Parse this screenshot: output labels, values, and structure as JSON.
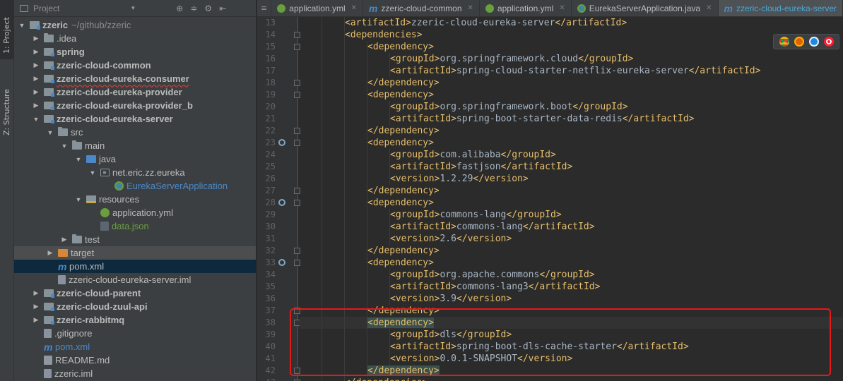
{
  "tool_strip": {
    "project_tab": "1: Project",
    "structure_tab": "Z: Structure"
  },
  "project_panel": {
    "title": "Project",
    "tree": [
      {
        "label": "zzeric",
        "path": "~/github/zzeric",
        "icon": "module-folder-icon",
        "arrow": "down",
        "depth": 0,
        "bold": true
      },
      {
        "label": ".idea",
        "icon": "folder-icon",
        "arrow": "right",
        "depth": 1
      },
      {
        "label": "spring",
        "icon": "module-folder-icon",
        "arrow": "right",
        "depth": 1,
        "bold": true
      },
      {
        "label": "zzeric-cloud-common",
        "icon": "module-folder-icon",
        "arrow": "right",
        "depth": 1,
        "bold": true
      },
      {
        "label": "zzeric-cloud-eureka-consumer",
        "icon": "module-folder-icon",
        "arrow": "right",
        "depth": 1,
        "bold": true,
        "underline": true
      },
      {
        "label": "zzeric-cloud-eureka-provider",
        "icon": "module-folder-icon",
        "arrow": "right",
        "depth": 1,
        "bold": true
      },
      {
        "label": "zzeric-cloud-eureka-provider_b",
        "icon": "module-folder-icon",
        "arrow": "right",
        "depth": 1,
        "bold": true
      },
      {
        "label": "zzeric-cloud-eureka-server",
        "icon": "module-folder-icon",
        "arrow": "down",
        "depth": 1,
        "bold": true
      },
      {
        "label": "src",
        "icon": "folder-icon",
        "arrow": "down",
        "depth": 2
      },
      {
        "label": "main",
        "icon": "folder-icon",
        "arrow": "down",
        "depth": 3
      },
      {
        "label": "java",
        "icon": "source-folder-icon",
        "arrow": "down",
        "depth": 4
      },
      {
        "label": "net.eric.zz.eureka",
        "icon": "package-icon",
        "arrow": "down",
        "depth": 5
      },
      {
        "label": "EurekaServerApplication",
        "icon": "spring-app-icon",
        "arrow": "none",
        "depth": 6,
        "color": "blue"
      },
      {
        "label": "resources",
        "icon": "resources-folder-icon",
        "arrow": "down",
        "depth": 4
      },
      {
        "label": "application.yml",
        "icon": "spring-config-icon",
        "arrow": "none",
        "depth": 5
      },
      {
        "label": "data.json",
        "icon": "json-file-icon",
        "arrow": "none",
        "depth": 5,
        "color": "green"
      },
      {
        "label": "test",
        "icon": "folder-icon",
        "arrow": "right",
        "depth": 3
      },
      {
        "label": "target",
        "icon": "target-folder-icon",
        "arrow": "right",
        "depth": 2,
        "state": "highlight"
      },
      {
        "label": "pom.xml",
        "icon": "maven-icon",
        "arrow": "none",
        "depth": 2,
        "state": "selected"
      },
      {
        "label": "zzeric-cloud-eureka-server.iml",
        "icon": "iml-file-icon",
        "arrow": "none",
        "depth": 2
      },
      {
        "label": "zzeric-cloud-parent",
        "icon": "module-folder-icon",
        "arrow": "right",
        "depth": 1,
        "bold": true
      },
      {
        "label": "zzeric-cloud-zuul-api",
        "icon": "module-folder-icon",
        "arrow": "right",
        "depth": 1,
        "bold": true
      },
      {
        "label": "zzeric-rabbitmq",
        "icon": "module-folder-icon",
        "arrow": "right",
        "depth": 1,
        "bold": true
      },
      {
        "label": ".gitignore",
        "icon": "text-file-icon",
        "arrow": "none",
        "depth": 1
      },
      {
        "label": "pom.xml",
        "icon": "maven-icon",
        "arrow": "none",
        "depth": 1,
        "color": "blue"
      },
      {
        "label": "README.md",
        "icon": "markdown-file-icon",
        "arrow": "none",
        "depth": 1
      },
      {
        "label": "zzeric.iml",
        "icon": "iml-file-icon",
        "arrow": "none",
        "depth": 1
      }
    ]
  },
  "editor": {
    "tabs": [
      {
        "label": "application.yml",
        "icon": "yml"
      },
      {
        "label": "zzeric-cloud-common",
        "icon": "m"
      },
      {
        "label": "application.yml",
        "icon": "yml"
      },
      {
        "label": "EurekaServerApplication.java",
        "icon": "app"
      },
      {
        "label": "zzeric-cloud-eureka-server",
        "icon": "m",
        "active": true
      }
    ],
    "first_line_number": 13,
    "lines": [
      {
        "indent": 2,
        "parts": [
          [
            "tag",
            "<artifactId>"
          ],
          [
            "txt",
            "zzeric-cloud-eureka-server"
          ],
          [
            "tag",
            "</artifactId>"
          ]
        ]
      },
      {
        "indent": 2,
        "parts": [
          [
            "tag",
            "<dependencies>"
          ]
        ],
        "fold": true
      },
      {
        "indent": 3,
        "parts": [
          [
            "tag",
            "<dependency>"
          ]
        ],
        "fold": true
      },
      {
        "indent": 4,
        "parts": [
          [
            "tag",
            "<groupId>"
          ],
          [
            "txt",
            "org.springframework.cloud"
          ],
          [
            "tag",
            "</groupId>"
          ]
        ]
      },
      {
        "indent": 4,
        "parts": [
          [
            "tag",
            "<artifactId>"
          ],
          [
            "txt",
            "spring-cloud-starter-netflix-eureka-server"
          ],
          [
            "tag",
            "</artifactId>"
          ]
        ]
      },
      {
        "indent": 3,
        "parts": [
          [
            "tag",
            "</dependency>"
          ]
        ],
        "fold": true
      },
      {
        "indent": 3,
        "parts": [
          [
            "tag",
            "<dependency>"
          ]
        ],
        "fold": true
      },
      {
        "indent": 4,
        "parts": [
          [
            "tag",
            "<groupId>"
          ],
          [
            "txt",
            "org.springframework.boot"
          ],
          [
            "tag",
            "</groupId>"
          ]
        ]
      },
      {
        "indent": 4,
        "parts": [
          [
            "tag",
            "<artifactId>"
          ],
          [
            "txt",
            "spring-boot-starter-data-redis"
          ],
          [
            "tag",
            "</artifactId>"
          ]
        ]
      },
      {
        "indent": 3,
        "parts": [
          [
            "tag",
            "</dependency>"
          ]
        ],
        "fold": true
      },
      {
        "indent": 3,
        "parts": [
          [
            "tag",
            "<dependency>"
          ]
        ],
        "fold": true,
        "mark": true
      },
      {
        "indent": 4,
        "parts": [
          [
            "tag",
            "<groupId>"
          ],
          [
            "txt",
            "com.alibaba"
          ],
          [
            "tag",
            "</groupId>"
          ]
        ]
      },
      {
        "indent": 4,
        "parts": [
          [
            "tag",
            "<artifactId>"
          ],
          [
            "txt",
            "fastjson"
          ],
          [
            "tag",
            "</artifactId>"
          ]
        ]
      },
      {
        "indent": 4,
        "parts": [
          [
            "tag",
            "<version>"
          ],
          [
            "txt",
            "1.2.29"
          ],
          [
            "tag",
            "</version>"
          ]
        ]
      },
      {
        "indent": 3,
        "parts": [
          [
            "tag",
            "</dependency>"
          ]
        ],
        "fold": true
      },
      {
        "indent": 3,
        "parts": [
          [
            "tag",
            "<dependency>"
          ]
        ],
        "fold": true,
        "mark": true
      },
      {
        "indent": 4,
        "parts": [
          [
            "tag",
            "<groupId>"
          ],
          [
            "txt",
            "commons-lang"
          ],
          [
            "tag",
            "</groupId>"
          ]
        ]
      },
      {
        "indent": 4,
        "parts": [
          [
            "tag",
            "<artifactId>"
          ],
          [
            "txt",
            "commons-lang"
          ],
          [
            "tag",
            "</artifactId>"
          ]
        ]
      },
      {
        "indent": 4,
        "parts": [
          [
            "tag",
            "<version>"
          ],
          [
            "txt",
            "2.6"
          ],
          [
            "tag",
            "</version>"
          ]
        ]
      },
      {
        "indent": 3,
        "parts": [
          [
            "tag",
            "</dependency>"
          ]
        ],
        "fold": true
      },
      {
        "indent": 3,
        "parts": [
          [
            "tag",
            "<dependency>"
          ]
        ],
        "fold": true,
        "mark": true
      },
      {
        "indent": 4,
        "parts": [
          [
            "tag",
            "<groupId>"
          ],
          [
            "txt",
            "org.apache.commons"
          ],
          [
            "tag",
            "</groupId>"
          ]
        ]
      },
      {
        "indent": 4,
        "parts": [
          [
            "tag",
            "<artifactId>"
          ],
          [
            "txt",
            "commons-lang3"
          ],
          [
            "tag",
            "</artifactId>"
          ]
        ]
      },
      {
        "indent": 4,
        "parts": [
          [
            "tag",
            "<version>"
          ],
          [
            "txt",
            "3.9"
          ],
          [
            "tag",
            "</version>"
          ]
        ]
      },
      {
        "indent": 3,
        "parts": [
          [
            "tag",
            "</dependency>"
          ]
        ],
        "fold": true
      },
      {
        "indent": 3,
        "parts": [
          [
            "tag-match",
            "<dependency>"
          ]
        ],
        "fold": true,
        "current": true
      },
      {
        "indent": 4,
        "parts": [
          [
            "tag",
            "<groupId>"
          ],
          [
            "txt",
            "dls"
          ],
          [
            "tag",
            "</groupId>"
          ]
        ]
      },
      {
        "indent": 4,
        "parts": [
          [
            "tag",
            "<artifactId>"
          ],
          [
            "txt",
            "spring-boot-dls-cache-starter"
          ],
          [
            "tag",
            "</artifactId>"
          ]
        ]
      },
      {
        "indent": 4,
        "parts": [
          [
            "tag",
            "<version>"
          ],
          [
            "txt",
            "0.0.1-SNAPSHOT"
          ],
          [
            "tag",
            "</version>"
          ]
        ]
      },
      {
        "indent": 3,
        "parts": [
          [
            "tag-match",
            "</dependency>"
          ]
        ],
        "fold": true
      },
      {
        "indent": 2,
        "parts": [
          [
            "tag",
            "</dependencies>"
          ]
        ],
        "fold": true
      }
    ]
  },
  "browser_icons": [
    "chrome-icon",
    "firefox-icon",
    "safari-icon",
    "opera-icon"
  ],
  "colors": {
    "accent": "#4aa8d8",
    "xml_tag": "#e8bf6a",
    "text": "#a9b7c6",
    "highlight_box": "#e81818",
    "selection": "#0d293e"
  }
}
